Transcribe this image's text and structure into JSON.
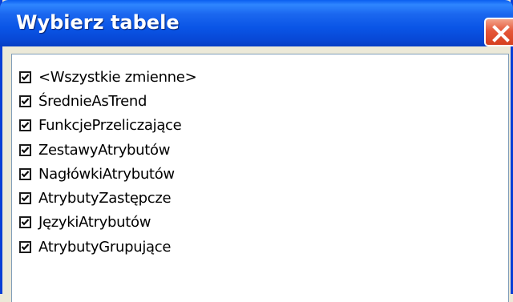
{
  "window": {
    "title": "Wybierz tabele",
    "close_icon": "close-icon"
  },
  "list": {
    "items": [
      {
        "label": "<Wszystkie zmienne>",
        "checked": true
      },
      {
        "label": "ŚrednieAsTrend",
        "checked": true
      },
      {
        "label": "FunkcjePrzeliczające",
        "checked": true
      },
      {
        "label": "ZestawyAtrybutów",
        "checked": true
      },
      {
        "label": "NagłówkiAtrybutów",
        "checked": true
      },
      {
        "label": "AtrybutyZastępcze",
        "checked": true
      },
      {
        "label": "JęzykiAtrybutów",
        "checked": true
      },
      {
        "label": "AtrybutyGrupujące",
        "checked": true
      }
    ]
  },
  "colors": {
    "titlebar": "#0a55e6",
    "close_button": "#e5583a",
    "list_border": "#7f9db9"
  }
}
